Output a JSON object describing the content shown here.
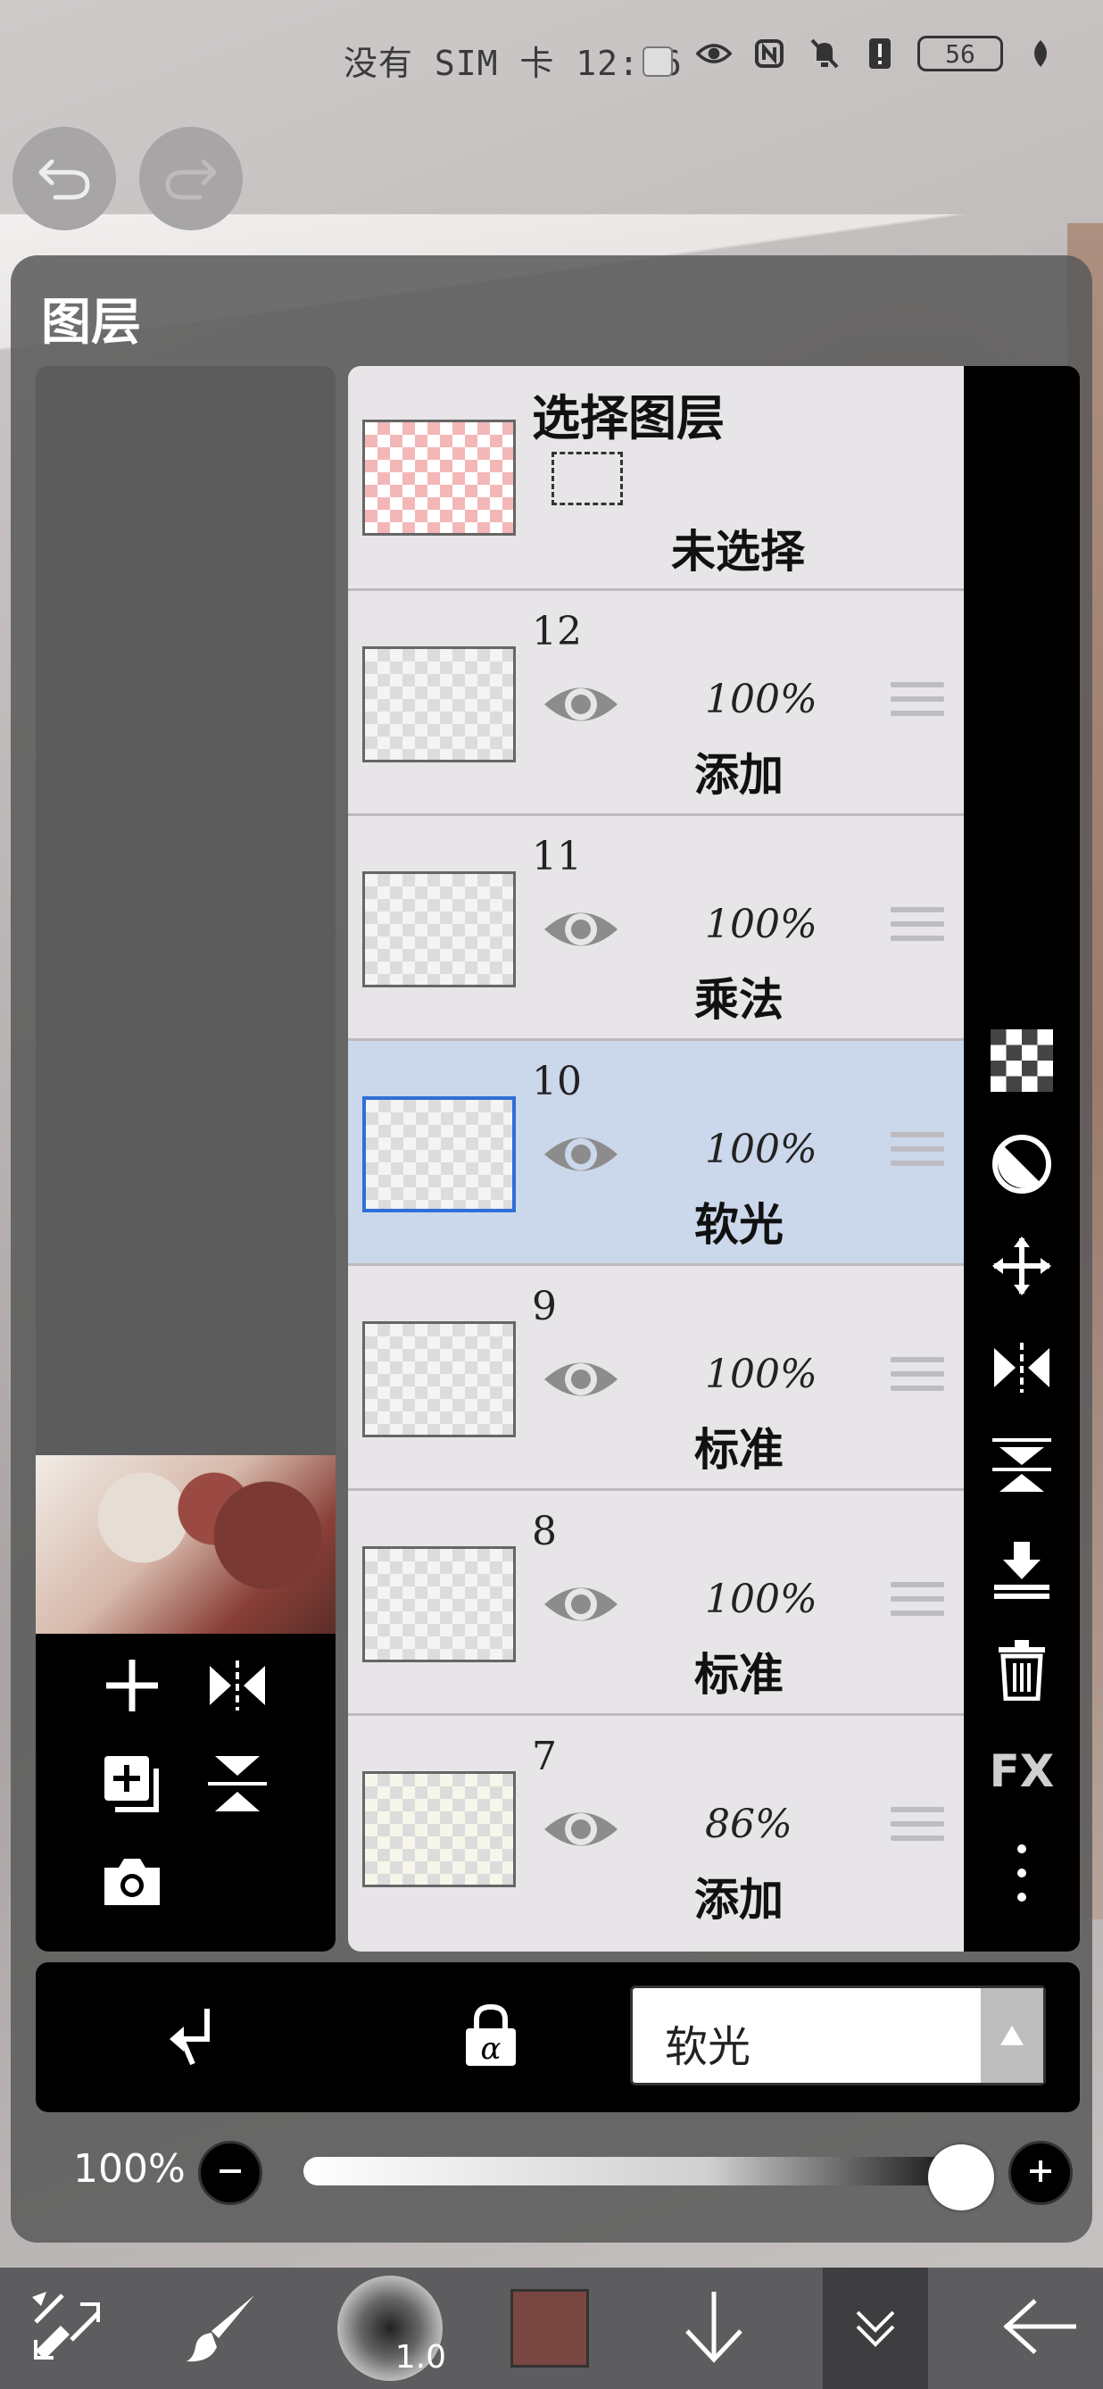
{
  "status_bar": {
    "text": "没有 SIM 卡 12:16",
    "battery": "56"
  },
  "panel": {
    "title": "图层"
  },
  "selection_layer": {
    "title": "选择图层",
    "status": "未选择"
  },
  "layers": [
    {
      "number": "12",
      "opacity": "100%",
      "blend": "添加"
    },
    {
      "number": "11",
      "opacity": "100%",
      "blend": "乘法"
    },
    {
      "number": "10",
      "opacity": "100%",
      "blend": "软光"
    },
    {
      "number": "9",
      "opacity": "100%",
      "blend": "标准"
    },
    {
      "number": "8",
      "opacity": "100%",
      "blend": "标准"
    },
    {
      "number": "7",
      "opacity": "86%",
      "blend": "添加"
    }
  ],
  "selected_layer_number": "10",
  "right_toolbar": {
    "fx_label": "FX"
  },
  "blend_mode": {
    "selected": "软光"
  },
  "opacity": {
    "value": "100%",
    "fraction": 1.0
  },
  "bottom_toolbar": {
    "brush_size": "1.0",
    "color": "#7a4641"
  },
  "icons": [
    "undo-icon",
    "redo-icon",
    "eye-icon",
    "plus-icon",
    "flip-horizontal-icon",
    "copy-layer-icon",
    "flip-vertical-icon",
    "camera-icon",
    "checker-icon",
    "half-circle-icon",
    "move-icon",
    "merge-down-icon",
    "trash-icon",
    "more-icon",
    "clipping-icon",
    "alpha-lock-icon",
    "transform-icon",
    "brush-icon",
    "arrow-down-icon",
    "chevron-double-down-icon",
    "back-arrow-icon"
  ]
}
